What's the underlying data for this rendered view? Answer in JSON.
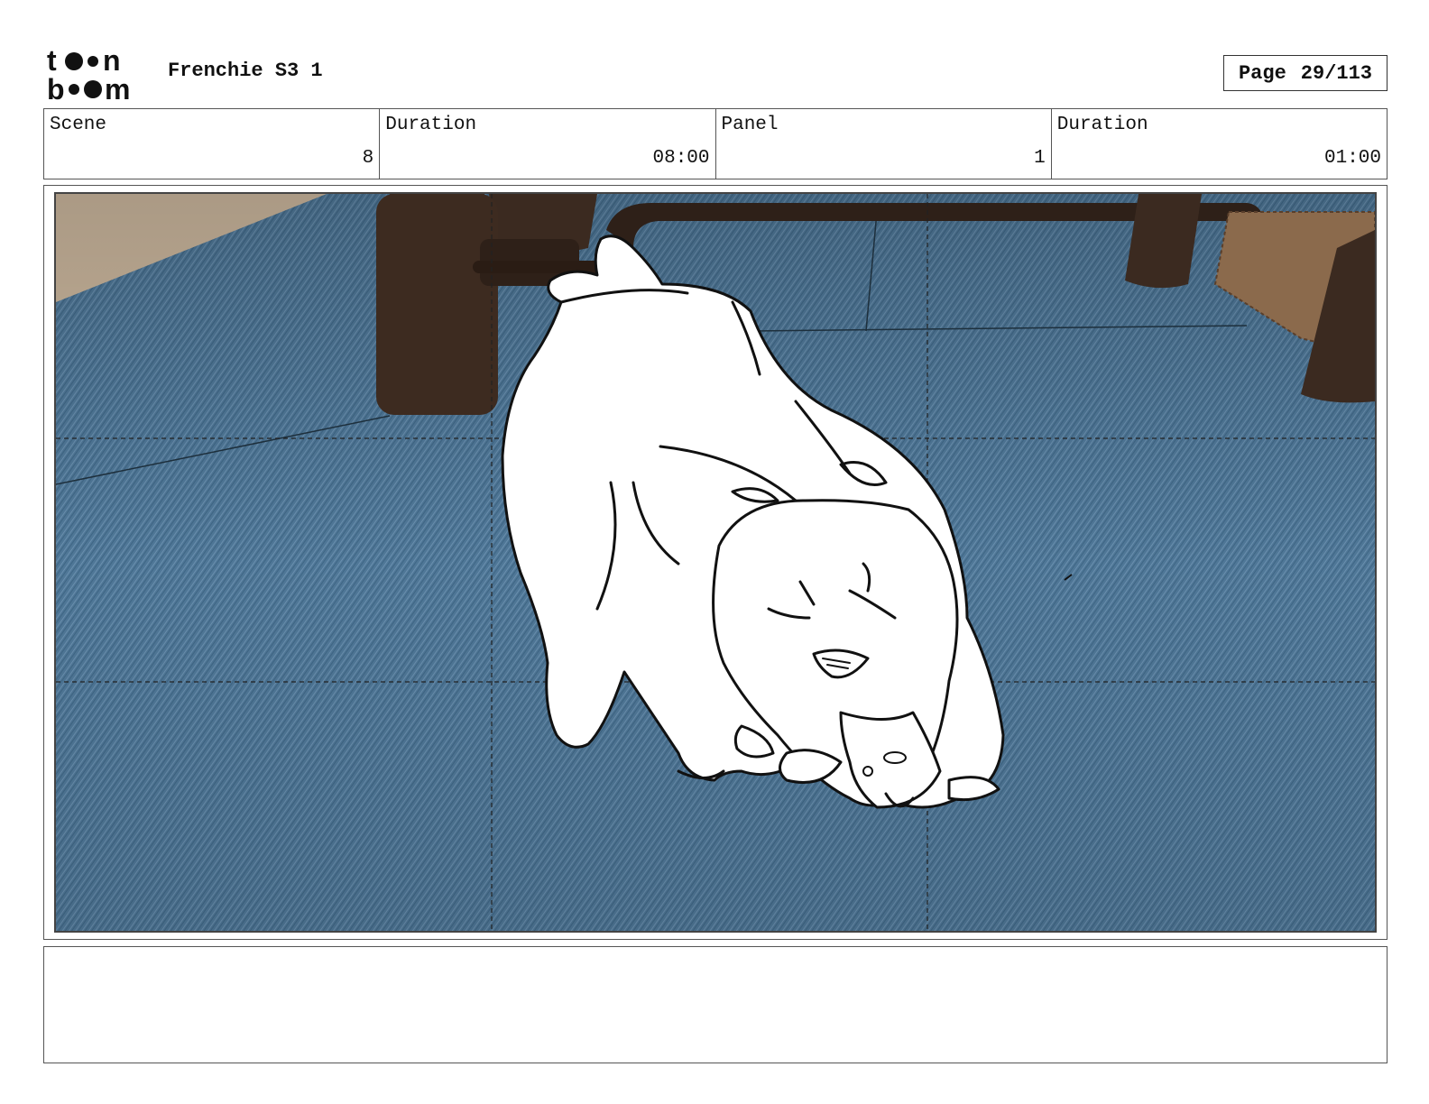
{
  "header": {
    "logo_alt": "toon boom",
    "title": "Frenchie S3 1",
    "page_label": "Page",
    "page_value": "29/113"
  },
  "info": {
    "scene_label": "Scene",
    "scene_value": "8",
    "scene_duration_label": "Duration",
    "scene_duration_value": "08:00",
    "panel_label": "Panel",
    "panel_value": "1",
    "panel_duration_label": "Duration",
    "panel_duration_value": "01:00"
  },
  "panel": {
    "image_description": "Storyboard sketch of a French bulldog sniffing a blue denim-textured rug under a wooden table",
    "rug_color": "#4f7797",
    "table_color": "#3b2a20"
  },
  "notes": {
    "text": ""
  }
}
